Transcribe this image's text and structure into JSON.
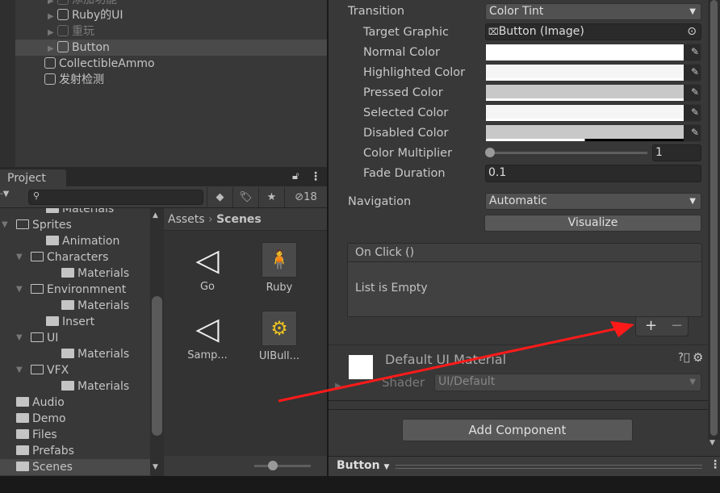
{
  "hierarchy": {
    "items": [
      {
        "label": "添加功能",
        "dim": true
      },
      {
        "label": "Ruby的UI"
      },
      {
        "label": "重玩",
        "dim": true
      },
      {
        "label": "Button",
        "selected": true
      },
      {
        "label": "CollectibleAmmo"
      },
      {
        "label": "发射检测"
      }
    ]
  },
  "project": {
    "tab": "Project",
    "hidden_count": "18",
    "search_placeholder": "",
    "tree": [
      {
        "label": "Materials"
      },
      {
        "label": "Sprites"
      },
      {
        "label": "Animation"
      },
      {
        "label": "Characters"
      },
      {
        "label": "Materials"
      },
      {
        "label": "Environmnent"
      },
      {
        "label": "Materials"
      },
      {
        "label": "Insert"
      },
      {
        "label": "UI"
      },
      {
        "label": "Materials"
      },
      {
        "label": "VFX"
      },
      {
        "label": "Materials"
      },
      {
        "label": "Audio"
      },
      {
        "label": "Demo"
      },
      {
        "label": "Files"
      },
      {
        "label": "Prefabs"
      },
      {
        "label": "Scenes"
      }
    ],
    "breadcrumb": {
      "root": "Assets",
      "current": "Scenes"
    },
    "assets": [
      {
        "label": "Go",
        "icon": "unity-scene-icon"
      },
      {
        "label": "Ruby",
        "icon": "sprite-icon"
      },
      {
        "label": "Samp...",
        "icon": "unity-scene-icon"
      },
      {
        "label": "UIBull...",
        "icon": "sprite-icon"
      }
    ]
  },
  "inspector": {
    "transition": {
      "label": "Transition",
      "value": "Color Tint"
    },
    "target_graphic": {
      "label": "Target Graphic",
      "value": "Button (Image)"
    },
    "colors": [
      {
        "label": "Normal Color",
        "color": "#ffffff"
      },
      {
        "label": "Highlighted Color",
        "color": "#f5f5f5"
      },
      {
        "label": "Pressed Color",
        "color": "#c8c8c8"
      },
      {
        "label": "Selected Color",
        "color": "#f5f5f5"
      },
      {
        "label": "Disabled Color",
        "color": "#c8c8c8"
      }
    ],
    "color_multiplier": {
      "label": "Color Multiplier",
      "value": "1"
    },
    "fade_duration": {
      "label": "Fade Duration",
      "value": "0.1"
    },
    "navigation": {
      "label": "Navigation",
      "value": "Automatic"
    },
    "visualize": "Visualize",
    "on_click": {
      "title": "On Click ()",
      "empty": "List is Empty",
      "add": "+",
      "remove": "−"
    },
    "material": {
      "name": "Default UI Material",
      "shader_label": "Shader",
      "shader": "UI/Default"
    },
    "add_component": "Add Component",
    "footer": "Button"
  },
  "annotation_color": "#ff1a1a"
}
